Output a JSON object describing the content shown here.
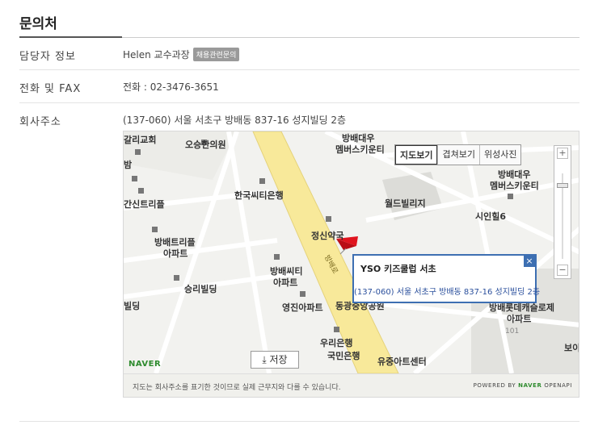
{
  "section": {
    "title": "문의처"
  },
  "contact_person": {
    "label": "담당자 정보",
    "value": "Helen 교수과장",
    "badge": "채용관련문의"
  },
  "phone": {
    "label": "전화 및 FAX",
    "value": "전화 : 02-3476-3651"
  },
  "address": {
    "label": "회사주소",
    "value": "(137-060) 서울 서초구 방배동 837-16 성지빌딩 2층"
  },
  "map": {
    "tabs": [
      "지도보기",
      "겹쳐보기",
      "위성사진"
    ],
    "zoom_in": "+",
    "zoom_out": "−",
    "labels": {
      "church": "갈리교회",
      "oseong": "오승한의원",
      "bangbae_daewoo_top": "방배대우",
      "members_top": "멤버스키운티",
      "bangbae_right": "방배대우",
      "members_right": "멤버스키운티",
      "hanguk_bank": "한국씨티은행",
      "world_building": "월드빌리지",
      "sinil": "시인힐6",
      "trepl_left": "간신트리플",
      "jeongsin": "정신약국",
      "bangbae_triple": "방배트리플",
      "triple_apt": "아파트",
      "bangbae_city": "방배씨티",
      "city_apt": "아파트",
      "seungni": "승리빌딩",
      "yeongjin": "영진아파트",
      "dongkwang": "동광중앙공원",
      "woori": "우리은행",
      "yujung": "유중아트센터",
      "bangbae_castle": "방배롯데캐슬로제",
      "castle_apt": "아파트",
      "bil": "빌딩",
      "bo": "보이",
      "road": "방배로",
      "building_no": "101",
      "gukmin": "국민은행",
      "bam": "밤"
    },
    "info_window": {
      "title": "YSO 키즈쿨럽 서초",
      "address": "(137-060) 서울 서초구 방배동 837-16 성지빌딩 2층",
      "close": "×"
    },
    "save_label": "⤓ 저장",
    "logo": "NAVER",
    "notice": "지도는 회사주소를 표기한 것이므로 실제 근무지와 다를 수 있습니다.",
    "powered_prefix": "POWERED BY",
    "powered_brand": "NAVER",
    "powered_suffix": "OPENAPI"
  }
}
